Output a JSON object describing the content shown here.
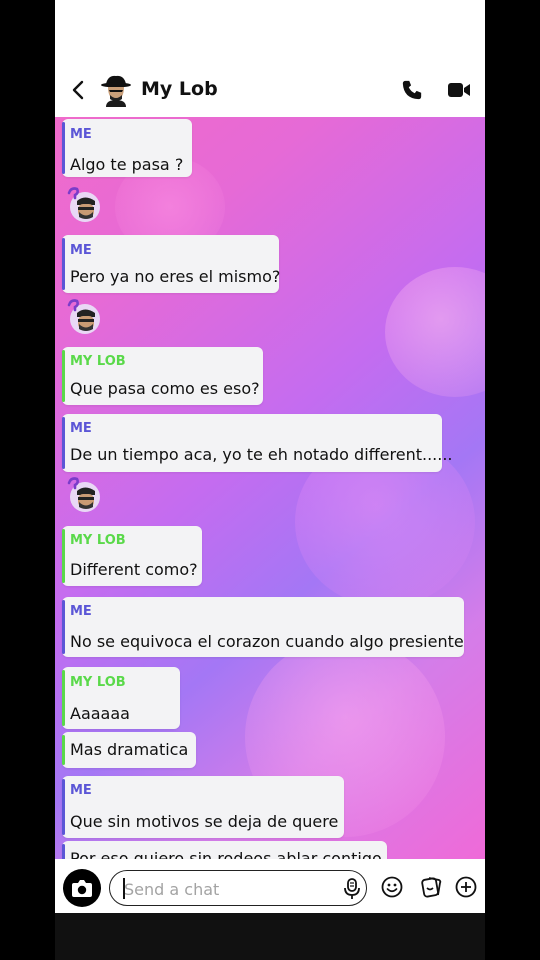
{
  "header": {
    "contact_name": "My Lob",
    "back_icon": "chevron-left-icon",
    "call_icon": "phone-icon",
    "video_icon": "video-camera-icon"
  },
  "colors": {
    "me": "#5b56d6",
    "contact": "#5ad94a"
  },
  "messages": [
    {
      "sender": "ME",
      "lines": [
        "Algo te pasa ?"
      ]
    },
    {
      "sender": "ME",
      "lines": [
        "Pero ya no eres el mismo?"
      ]
    },
    {
      "sender": "MY LOB",
      "lines": [
        "Que pasa como es eso?"
      ]
    },
    {
      "sender": "ME",
      "lines": [
        "De un tiempo aca, yo te eh notado different......"
      ]
    },
    {
      "sender": "MY LOB",
      "lines": [
        "Different como?"
      ]
    },
    {
      "sender": "ME",
      "lines": [
        "No se equivoca el corazon cuando algo presiente"
      ]
    },
    {
      "sender": "MY LOB",
      "lines": [
        "Aaaaaa",
        "Mas dramatica"
      ]
    },
    {
      "sender": "ME",
      "lines": [
        "Que sin motivos se deja de quere",
        "Por eso quiero sin rodeos ablar contigo"
      ]
    }
  ],
  "input": {
    "placeholder": "Send a chat"
  }
}
